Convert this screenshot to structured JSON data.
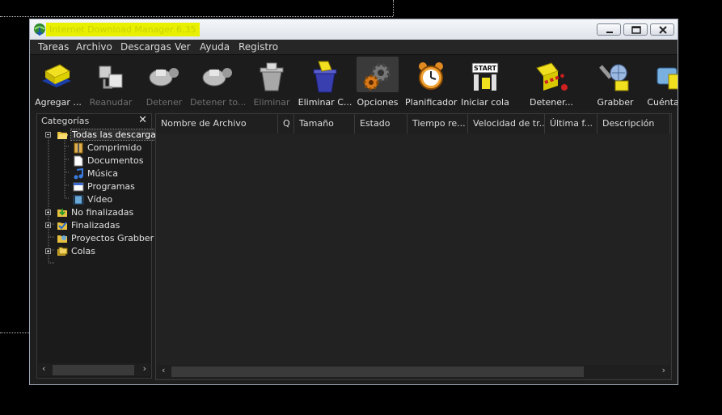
{
  "window": {
    "title": "Internet Download Manager 6.35"
  },
  "menu": [
    "Tareas",
    "Archivo",
    "Descargas",
    "Ver",
    "Ayuda",
    "Registro"
  ],
  "toolbar": [
    {
      "label": "Agregar ...",
      "icon": "add-url-icon",
      "enabled": true
    },
    {
      "label": "Reanudar",
      "icon": "resume-icon",
      "enabled": false
    },
    {
      "label": "Detener",
      "icon": "stop-icon",
      "enabled": false
    },
    {
      "label": "Detener to...",
      "icon": "stop-all-icon",
      "enabled": false
    },
    {
      "label": "Eliminar",
      "icon": "delete-icon",
      "enabled": false
    },
    {
      "label": "Eliminar C...",
      "icon": "delete-completed-icon",
      "enabled": true
    },
    {
      "label": "Opciones",
      "icon": "options-gear-icon",
      "enabled": true
    },
    {
      "label": "Planificador",
      "icon": "scheduler-alarm-clock-icon",
      "enabled": true
    },
    {
      "label": "Iniciar cola",
      "icon": "start-queue-icon",
      "enabled": true
    },
    {
      "label": "Detener...",
      "icon": "stop-queue-icon",
      "enabled": true
    },
    {
      "label": "Grabber",
      "icon": "grabber-icon",
      "enabled": true
    },
    {
      "label": "Cuéntale",
      "icon": "tell-friend-icon",
      "enabled": true
    }
  ],
  "categories": {
    "header": "Categorías",
    "close_glyph": "✕",
    "items": [
      {
        "label": "Todas las descargas",
        "level": 0,
        "expander": "minus",
        "icon": "folder-open-icon",
        "selected": true
      },
      {
        "label": "Comprimido",
        "level": 1,
        "icon": "archive-icon"
      },
      {
        "label": "Documentos",
        "level": 1,
        "icon": "document-icon"
      },
      {
        "label": "Música",
        "level": 1,
        "icon": "music-note-icon"
      },
      {
        "label": "Programas",
        "level": 1,
        "icon": "program-window-icon"
      },
      {
        "label": "Vídeo",
        "level": 1,
        "icon": "video-film-icon"
      },
      {
        "label": "No finalizadas",
        "level": 0,
        "expander": "plus",
        "icon": "unfinished-download-icon"
      },
      {
        "label": "Finalizadas",
        "level": 0,
        "expander": "plus",
        "icon": "finished-checkmark-icon"
      },
      {
        "label": "Proyectos Grabber",
        "level": 0,
        "icon": "grabber-project-icon"
      },
      {
        "label": "Colas",
        "level": 0,
        "expander": "plus",
        "icon": "queues-folder-icon"
      }
    ]
  },
  "columns": [
    "Nombre de Archivo",
    "Q",
    "Tamaño",
    "Estado",
    "Tiempo re...",
    "Velocidad de tr...",
    "Última f...",
    "Descripción"
  ],
  "colors": {
    "background": "#000000",
    "panel": "#1e1e1e",
    "title_highlight": "#e8f000",
    "text": "#dddddd"
  }
}
